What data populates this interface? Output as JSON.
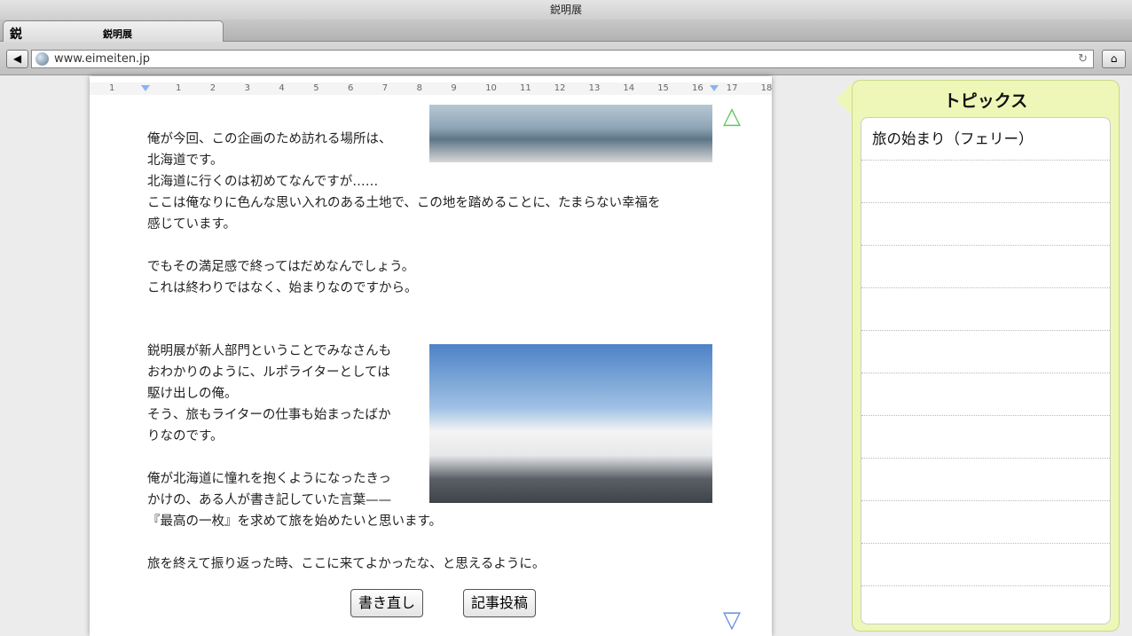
{
  "window": {
    "title": "鋭明展"
  },
  "tab": {
    "icon_char": "鋭",
    "label": "鋭明展"
  },
  "nav": {
    "back_icon": "◀",
    "url": "www.eimeiten.jp",
    "reload_icon": "↻",
    "home_icon": "⌂"
  },
  "ruler": {
    "labels": [
      "1",
      "1",
      "2",
      "3",
      "4",
      "5",
      "6",
      "7",
      "8",
      "9",
      "10",
      "11",
      "12",
      "13",
      "14",
      "15",
      "16",
      "17",
      "18"
    ]
  },
  "article": {
    "block1": "俺が今回、この企画のため訪れる場所は、\n北海道です。\n北海道に行くのは初めてなんですが……\nここは俺なりに色んな思い入れのある土地で、この地を踏めることに、たまらない幸福を\n感じています。\n\nでもその満足感で終ってはだめなんでしょう。\nこれは終わりではなく、始まりなのですから。",
    "block2": "鋭明展が新人部門ということでみなさんも\nおわかりのように、ルポライターとしては\n駆け出しの俺。\nそう、旅もライターの仕事も始まったばか\nりなのです。\n\n俺が北海道に憧れを抱くようになったきっ\nかけの、ある人が書き記していた言葉——\n『最高の一枚』を求めて旅を始めたいと思います。\n\n旅を終えて振り返った時、ここに来てよかったな、と思えるように。",
    "rewrite_button": "書き直し",
    "post_button": "記事投稿",
    "scroll_up_icon": "△",
    "scroll_down_icon": "▽"
  },
  "topics": {
    "title": "トピックス",
    "items": [
      "旅の始まり（フェリー）",
      "",
      "",
      "",
      "",
      "",
      "",
      "",
      "",
      "",
      "",
      ""
    ]
  },
  "colors": {
    "panel": "#eef7b8",
    "up_arrow": "#5cc85c",
    "down_arrow": "#6a8fe0"
  }
}
